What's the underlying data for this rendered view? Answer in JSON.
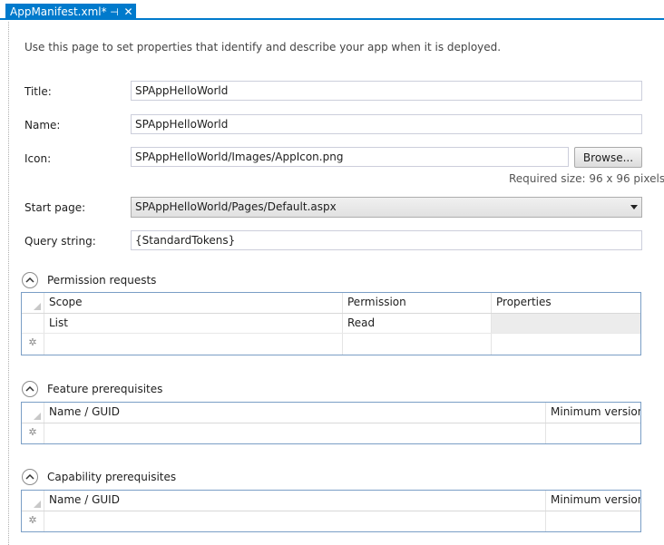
{
  "tab": {
    "title": "AppManifest.xml*"
  },
  "intro": "Use this page to set properties that identify and describe your app when it is deployed.",
  "fields": {
    "title": {
      "label": "Title:",
      "value": "SPAppHelloWorld"
    },
    "name": {
      "label": "Name:",
      "value": "SPAppHelloWorld"
    },
    "icon": {
      "label": "Icon:",
      "value": "SPAppHelloWorld/Images/AppIcon.png",
      "browse": "Browse...",
      "hint": "Required size: 96 x 96 pixels"
    },
    "start_page": {
      "label": "Start page:",
      "value": "SPAppHelloWorld/Pages/Default.aspx"
    },
    "query_string": {
      "label": "Query string:",
      "value": "{StandardTokens}"
    }
  },
  "permissions": {
    "title": "Permission requests",
    "columns": [
      "Scope",
      "Permission",
      "Properties"
    ],
    "rows": [
      {
        "scope": "List",
        "permission": "Read",
        "properties": ""
      }
    ]
  },
  "features": {
    "title": "Feature prerequisites",
    "columns": [
      "Name / GUID",
      "Minimum version"
    ]
  },
  "capabilities": {
    "title": "Capability prerequisites",
    "columns": [
      "Name / GUID",
      "Minimum version"
    ]
  }
}
